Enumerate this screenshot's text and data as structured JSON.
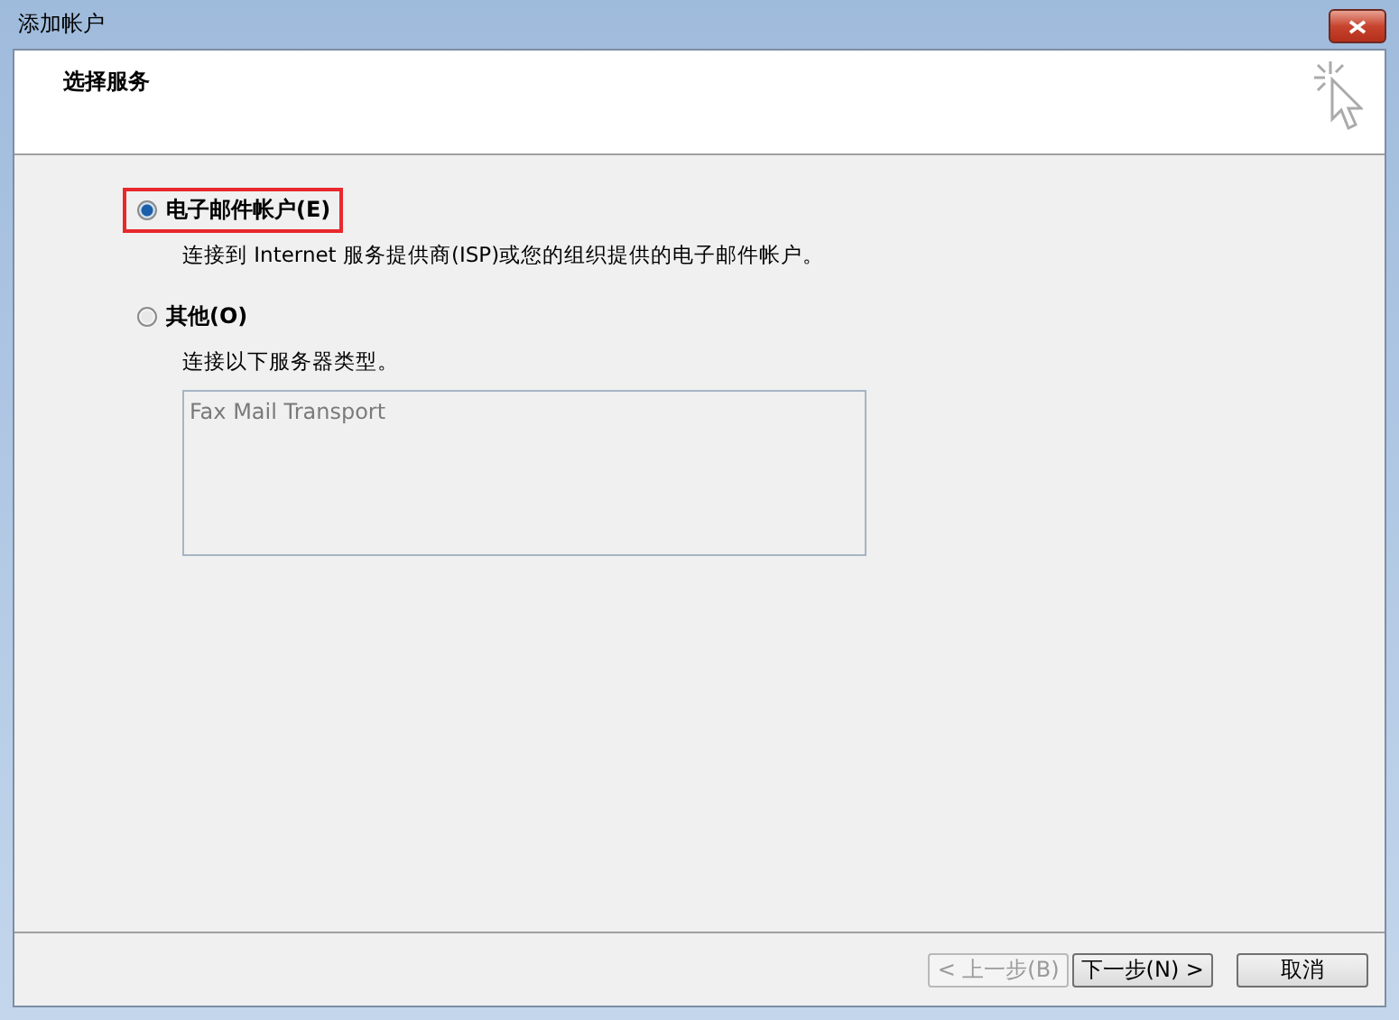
{
  "window": {
    "title": "添加帐户"
  },
  "header": {
    "title": "选择服务"
  },
  "options": [
    {
      "label": "电子邮件帐户(E)",
      "selected": true,
      "highlighted": true,
      "description": "连接到 Internet 服务提供商(ISP)或您的组织提供的电子邮件帐户。"
    },
    {
      "label": "其他(O)",
      "selected": false,
      "highlighted": false,
      "description": "连接以下服务器类型。",
      "list": [
        "Fax Mail Transport"
      ]
    }
  ],
  "buttons": [
    {
      "label": "< 上一步(B)",
      "disabled": true
    },
    {
      "label": "下一步(N) >",
      "disabled": false
    },
    {
      "label": "取消",
      "disabled": false
    }
  ]
}
